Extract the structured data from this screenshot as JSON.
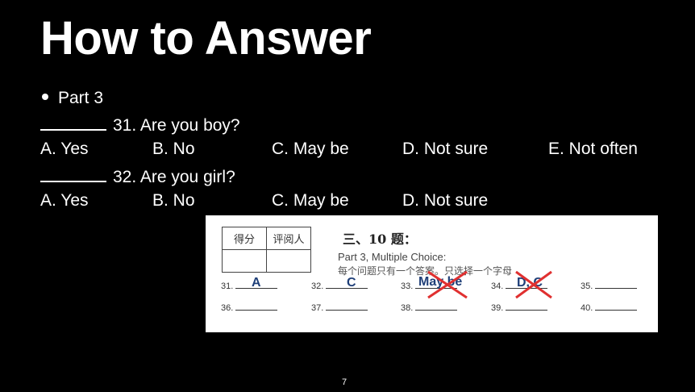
{
  "title": "How to Answer",
  "bullet": "Part 3",
  "questions": [
    {
      "text": "31. Are you boy?",
      "options": [
        "A. Yes",
        "B. No",
        "C. May be",
        "D. Not sure",
        "E. Not often"
      ]
    },
    {
      "text": "32. Are you girl?",
      "options": [
        "A. Yes",
        "B. No",
        "C. May be",
        "D. Not sure"
      ]
    }
  ],
  "sheet": {
    "table_headers": [
      "得分",
      "评阅人"
    ],
    "section_title": "三、10 题：",
    "section_subtitle": "Part 3, Multiple Choice:",
    "instruction": "每个问题只有一个答案。只选择一个字母",
    "row1": [
      "31.",
      "32.",
      "33.",
      "34.",
      "35."
    ],
    "row2": [
      "36.",
      "37.",
      "38.",
      "39.",
      "40."
    ],
    "handwritten": {
      "q31": "A",
      "q32": "C",
      "q33": "May be",
      "q34": "D, C"
    }
  },
  "page_number": "7",
  "colors": {
    "handwriting": "#1f3f78",
    "cross": "#e03030"
  }
}
